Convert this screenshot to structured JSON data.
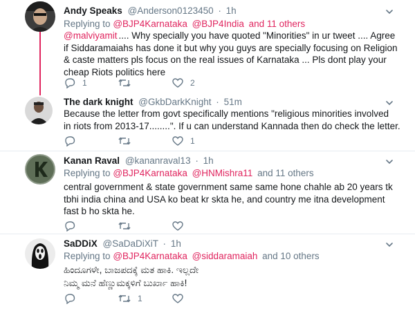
{
  "tweets": [
    {
      "name": "Andy Speaks",
      "handle": "@Anderson0123450",
      "time": "1h",
      "reply_prefix": "Replying to",
      "reply_mentions": [
        "@BJP4Karnataka",
        "@BJP4India"
      ],
      "reply_suffix": "and 11 others",
      "body_mention": "@malviyamit",
      "body_lines": [
        ".... Why specially you have quoted \"Minorities\" in ur tweet .... Agree",
        "if Siddaramaiahs has done it but why you guys are specially focusing on Religion",
        "& caste matters pls focus on the real issues of Karnataka ... Pls dont play your",
        "cheap Riots politics here"
      ],
      "reply_count": "1",
      "retweet_count": "",
      "like_count": "2"
    },
    {
      "name": "The dark knight",
      "handle": "@GkbDarkKnight",
      "time": "51m",
      "body_lines": [
        "Because the letter from govt specifically mentions \"religious minorities involved",
        "in riots from 2013-17........\". If u can understand Kannada then do check the letter."
      ],
      "reply_count": "",
      "retweet_count": "",
      "like_count": "1"
    },
    {
      "name": "Kanan Raval",
      "handle": "@kananraval13",
      "time": "1h",
      "reply_prefix": "Replying to",
      "reply_mentions": [
        "@BJP4Karnataka",
        "@HNMishra11"
      ],
      "reply_suffix": "and 11 others",
      "body_lines": [
        "central government & state government same same hone chahle ab 20 years tk",
        "tbhi india china and USA ko beat kr skta he, and country me itna development",
        "fast b ho skta he."
      ],
      "reply_count": "",
      "retweet_count": "",
      "like_count": ""
    },
    {
      "name": "SaDDiX",
      "handle": "@SaDaDiXiT",
      "time": "1h",
      "reply_prefix": "Replying to",
      "reply_mentions": [
        "@BJP4Karnataka",
        "@siddaramaiah"
      ],
      "reply_suffix": "and 10 others",
      "body_lines": [
        "ಹಿಂದೂಗಳೇ, ಬಾಜಪದಕ್ಕೆ ಮತ ಹಾಕಿ. ಇಲ್ಲದೇ",
        "ನಿಮ್ಮ ಮನೆ ಹೆಣ್ಣುಮಕ್ಕಳಿಗೆ ಬುರ್ಖಾ ಹಾಕಿ!"
      ],
      "reply_count": "",
      "retweet_count": "1",
      "like_count": ""
    }
  ],
  "colors": {
    "mention": "#e0245e",
    "secondary_text": "#657786",
    "icon": "#657786",
    "thread_line": "#e0245e",
    "divider": "#e6ecf0"
  },
  "icons": [
    "reply-icon",
    "retweet-icon",
    "like-icon",
    "caret-down-icon"
  ]
}
